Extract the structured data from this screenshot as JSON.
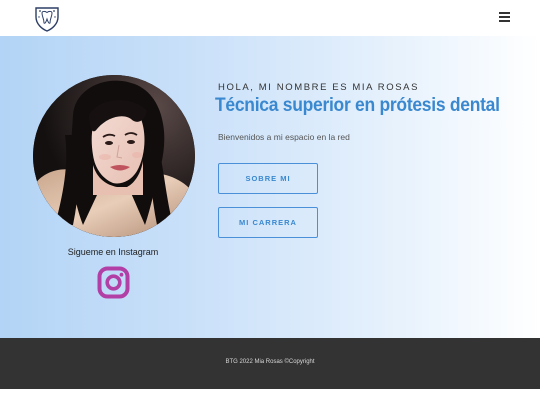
{
  "header": {
    "logo_icon": "tooth-shield-logo",
    "menu_icon": "hamburger-menu-icon"
  },
  "hero": {
    "eyebrow": "HOLA, MI NOMBRE ES MIA ROSAS",
    "headline": "Técnica superior en prótesis dental",
    "intro": "Bienvenidos a mi espacio en la red",
    "buttons": {
      "about_label": "SOBRE MI",
      "career_label": "MI CARRERA"
    },
    "instagram": {
      "label": "Sigueme en Instagram",
      "icon": "instagram-icon",
      "color": "#b23fa6"
    },
    "accent_color": "#3a88cf",
    "gradient_start": "#b3d4f6"
  },
  "footer": {
    "copyright": "BTG 2022 Mia Rosas ©Copyright",
    "background": "#333333"
  }
}
